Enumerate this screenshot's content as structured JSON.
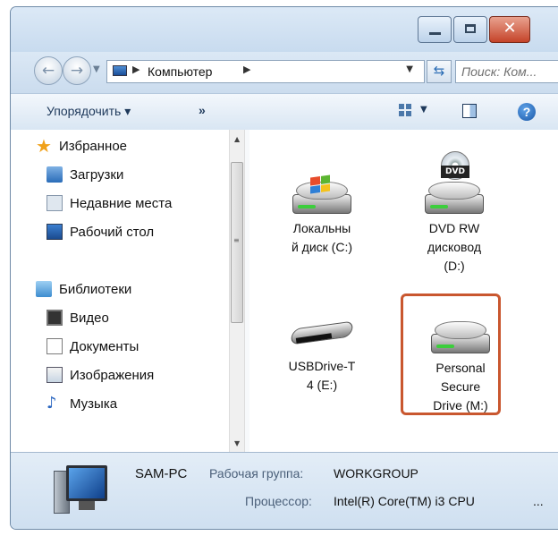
{
  "window": {
    "controls": {
      "minimize": "minimize",
      "maximize": "maximize",
      "close": "close"
    }
  },
  "address": {
    "crumb": "Компьютер",
    "search_placeholder": "Поиск: Ком..."
  },
  "toolbar": {
    "organize_label": "Упорядочить ▾",
    "more_label": "»"
  },
  "nav": {
    "favorites_header": "Избранное",
    "favorites": [
      {
        "label": "Загрузки",
        "icon": "downloads-icon"
      },
      {
        "label": "Недавние места",
        "icon": "recent-places-icon"
      },
      {
        "label": "Рабочий стол",
        "icon": "desktop-icon"
      }
    ],
    "libraries_header": "Библиотеки",
    "libraries": [
      {
        "label": "Видео",
        "icon": "video-icon"
      },
      {
        "label": "Документы",
        "icon": "documents-icon"
      },
      {
        "label": "Изображения",
        "icon": "pictures-icon"
      },
      {
        "label": "Музыка",
        "icon": "music-icon"
      }
    ]
  },
  "drives": [
    {
      "line1": "Локальны",
      "line2": "й диск (C:)",
      "line3": "",
      "icon": "local-disk-icon"
    },
    {
      "line1": "DVD RW",
      "line2": "дисковод",
      "line3": "(D:)",
      "icon": "dvd-drive-icon",
      "badge": "DVD"
    },
    {
      "line1": "USBDrive-T",
      "line2": "4 (E:)",
      "line3": "",
      "icon": "usb-drive-icon"
    },
    {
      "line1": "Personal",
      "line2": "Secure",
      "line3": "Drive (M:)",
      "icon": "hard-disk-icon"
    }
  ],
  "details": {
    "computer_name": "SAM-PC",
    "workgroup_label": "Рабочая группа:",
    "workgroup_value": "WORKGROUP",
    "cpu_label": "Процессор:",
    "cpu_value": "Intel(R) Core(TM) i3 CPU",
    "ellipsis": "..."
  },
  "colors": {
    "highlight": "#c9572f",
    "close_button": "#c5442a",
    "window_frame": "#cfe0f1"
  }
}
